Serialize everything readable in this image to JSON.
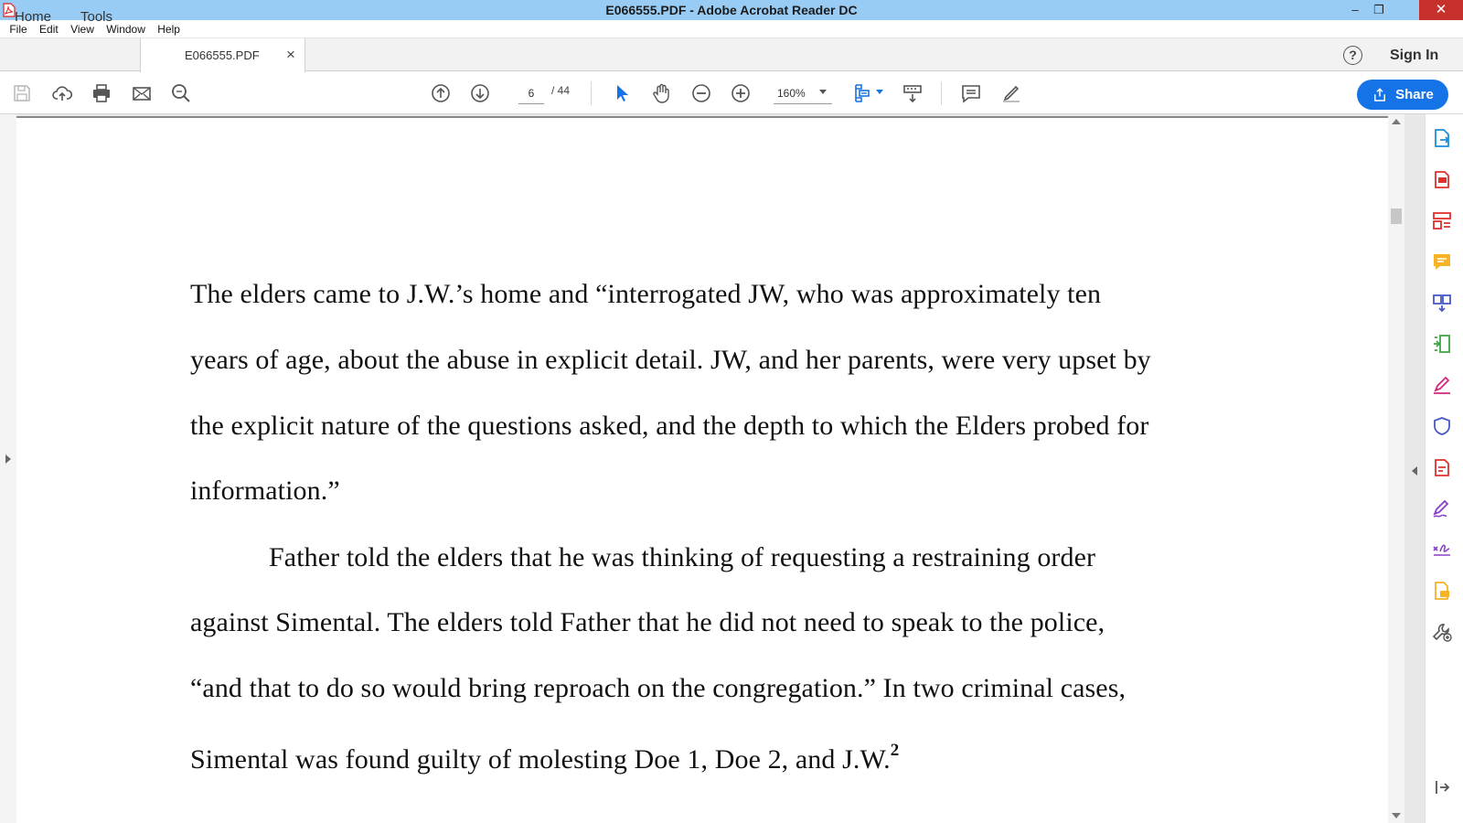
{
  "window": {
    "title": "E066555.PDF - Adobe Acrobat Reader DC",
    "minimize": "–",
    "restore": "❐",
    "close": "✕"
  },
  "menu": [
    "File",
    "Edit",
    "View",
    "Window",
    "Help"
  ],
  "tabs": {
    "home": "Home",
    "tools": "Tools",
    "document": "E066555.PDF",
    "close_glyph": "×"
  },
  "header_right": {
    "help_glyph": "?",
    "sign_in": "Sign In"
  },
  "toolbar": {
    "page_current": "6",
    "page_total": "/ 44",
    "zoom": "160%",
    "share": "Share"
  },
  "document": {
    "lines": [
      "The elders came to J.W.’s home and “interrogated JW, who was approximately ten",
      "years of age, about the abuse in explicit detail.  JW, and her parents, were very upset by",
      "the explicit nature of the questions asked, and the depth to which the Elders probed for",
      "information.”",
      "Father told the elders that he was thinking of requesting a restraining order",
      "against Simental.  The elders told Father that he did not need to speak to the police,",
      "“and that to do so would bring reproach on the congregation.”  In two criminal cases,",
      "Simental was found guilty of molesting Doe 1, Doe 2, and J.W."
    ],
    "footnote_ref": "2"
  },
  "colors": {
    "titlebar": "#99ccf5",
    "accent": "#1473e6",
    "close": "#c7312b"
  }
}
